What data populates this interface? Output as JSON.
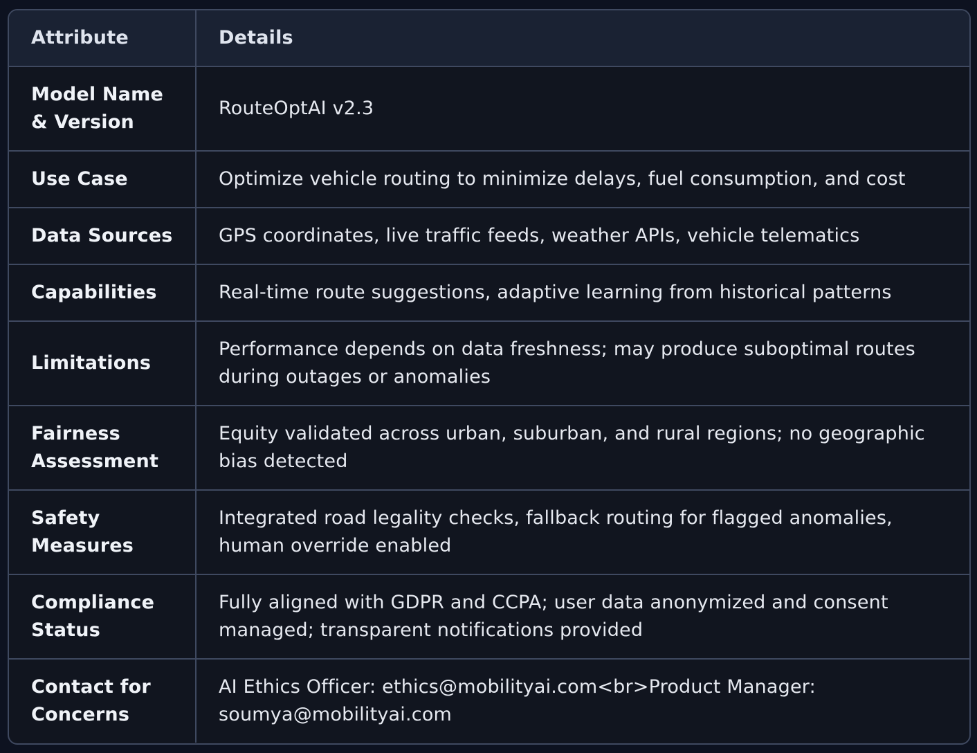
{
  "table": {
    "headers": {
      "attribute": "Attribute",
      "details": "Details"
    },
    "rows": [
      {
        "attribute": "Model Name & Version",
        "details": "RouteOptAI v2.3"
      },
      {
        "attribute": "Use Case",
        "details": "Optimize vehicle routing to minimize delays, fuel consumption, and cost"
      },
      {
        "attribute": "Data Sources",
        "details": "GPS coordinates, live traffic feeds, weather APIs, vehicle telematics"
      },
      {
        "attribute": "Capabilities",
        "details": "Real-time route suggestions, adaptive learning from historical patterns"
      },
      {
        "attribute": "Limitations",
        "details": "Performance depends on data freshness; may produce suboptimal routes during outages or anomalies"
      },
      {
        "attribute": "Fairness Assessment",
        "details": "Equity validated across urban, suburban, and rural regions; no geographic bias detected"
      },
      {
        "attribute": "Safety Measures",
        "details": "Integrated road legality checks, fallback routing for flagged anomalies, human override enabled"
      },
      {
        "attribute": "Compliance Status",
        "details": "Fully aligned with GDPR and CCPA; user data anonymized and consent managed; transparent notifications provided"
      },
      {
        "attribute": "Contact for Concerns",
        "details": "AI Ethics Officer: ethics@mobilityai.com<br>Product Manager: soumya@mobilityai.com"
      }
    ]
  }
}
